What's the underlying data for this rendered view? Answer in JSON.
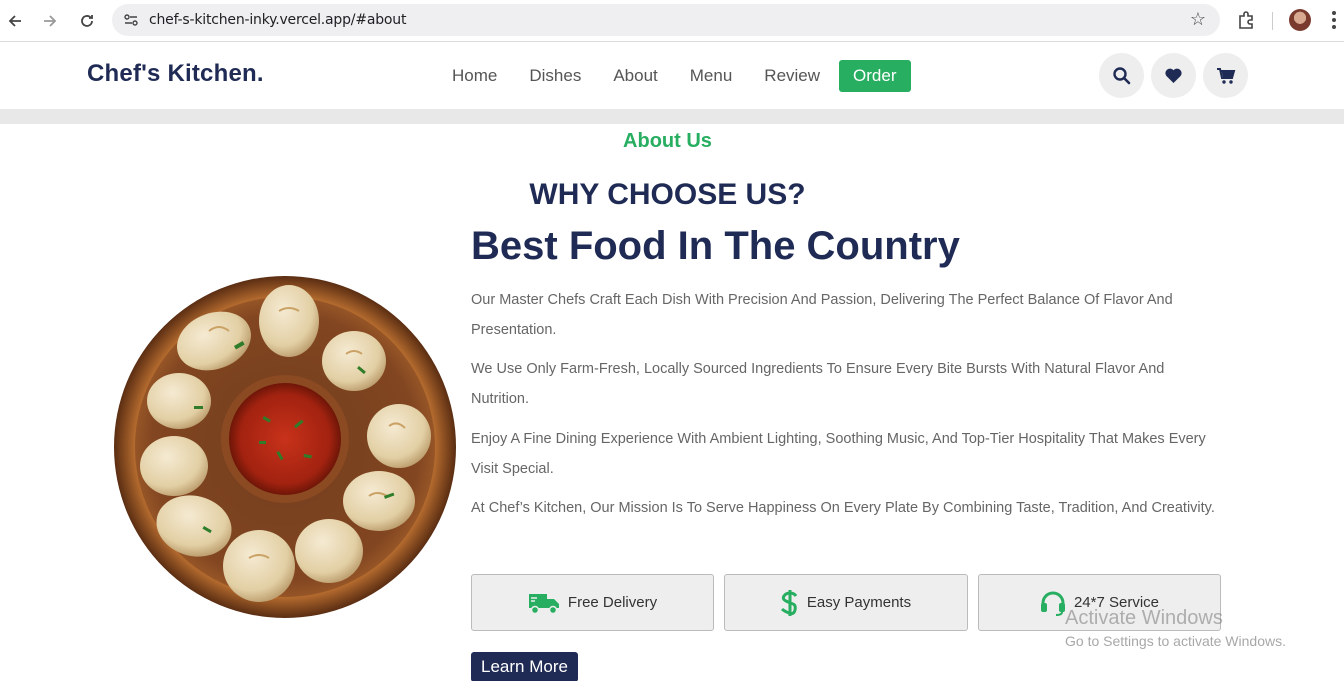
{
  "browser": {
    "url": "chef-s-kitchen-inky.vercel.app/#about"
  },
  "header": {
    "logo": "Chef's Kitchen.",
    "nav": {
      "home": "Home",
      "dishes": "Dishes",
      "about": "About",
      "menu": "Menu",
      "review": "Review",
      "order": "Order"
    }
  },
  "about": {
    "section_label": "About Us",
    "heading": "WHY CHOOSE US?",
    "title": "Best Food In The Country",
    "paragraphs": [
      "Our Master Chefs Craft Each Dish With Precision And Passion, Delivering The Perfect Balance Of Flavor And Presentation.",
      "We Use Only Farm-Fresh, Locally Sourced Ingredients To Ensure Every Bite Bursts With Natural Flavor And Nutrition.",
      "Enjoy A Fine Dining Experience With Ambient Lighting, Soothing Music, And Top-Tier Hospitality That Makes Every Visit Special.",
      "At Chef’s Kitchen, Our Mission Is To Serve Happiness On Every Plate By Combining Taste, Tradition, And Creativity."
    ],
    "features": {
      "delivery": "Free Delivery",
      "payments": "Easy Payments",
      "service": "24*7 Service"
    },
    "learn_more": "Learn More"
  },
  "watermark": {
    "line1": "Activate Windows",
    "line2": "Go to Settings to activate Windows."
  },
  "colors": {
    "accent_green": "#27ae60",
    "navy": "#1f2b54"
  }
}
